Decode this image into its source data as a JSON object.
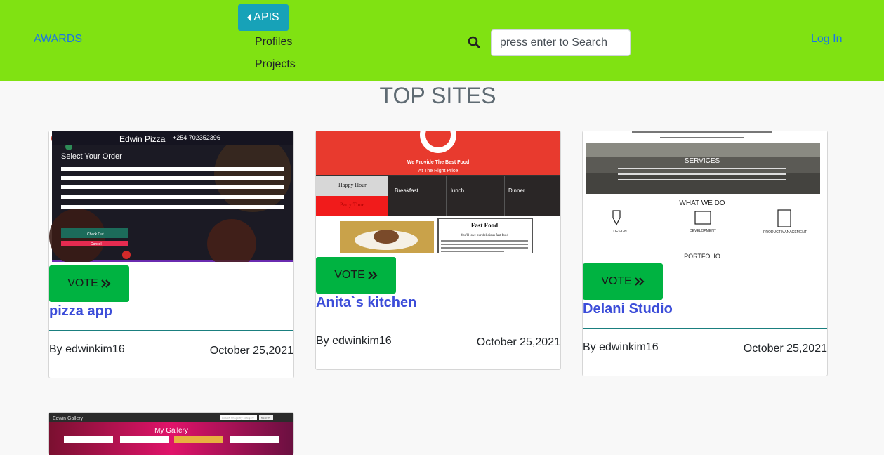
{
  "nav": {
    "brand": "AWARDS",
    "apis_label": "APIS",
    "dropdown_items": [
      "Profiles",
      "Projects"
    ],
    "search_placeholder": "press enter to Search",
    "login": "Log In"
  },
  "page_title": "TOP SITES",
  "vote_label": "VOTE",
  "cards": [
    {
      "title": "pizza app",
      "author": "By edwinkim16",
      "date": "October 25,2021",
      "preview": {
        "header": "Edwin Pizza",
        "phone": "+254 702352396",
        "heading": "Select Your Order",
        "checkout": "Check Out",
        "cancel": "Cancel"
      }
    },
    {
      "title": "Anita`s kitchen",
      "author": "By edwinkim16",
      "date": "October 25,2021",
      "preview": {
        "tagline1": "We Provide The Best Food",
        "tagline2": "At The Right Price",
        "happy": "Happy Hour",
        "party": "Party Time",
        "menu": [
          "Breakfast",
          "lunch",
          "Dinner"
        ],
        "fastfood": "Fast Food",
        "fastfood_sub": "You'll love our delicious fast food"
      }
    },
    {
      "title": "Delani Studio",
      "author": "By edwinkim16",
      "date": "October 25,2021",
      "preview": {
        "services": "SERVICES",
        "what": "WHAT WE DO",
        "items": [
          "DESIGN",
          "DEVELOPMENT",
          "PRODUCT MANAGEMENT"
        ],
        "portfolio": "PORTFOLIO"
      }
    },
    {
      "preview": {
        "header": "Edwin Gallery",
        "heading": "My Gallery",
        "search": "search image by category",
        "search_btn": "Search"
      }
    }
  ],
  "colors": {
    "navbar": "#80e212",
    "apis": "#17a2b8",
    "vote": "#00b341",
    "title": "#3c4dd9",
    "link": "#1a73e8"
  }
}
